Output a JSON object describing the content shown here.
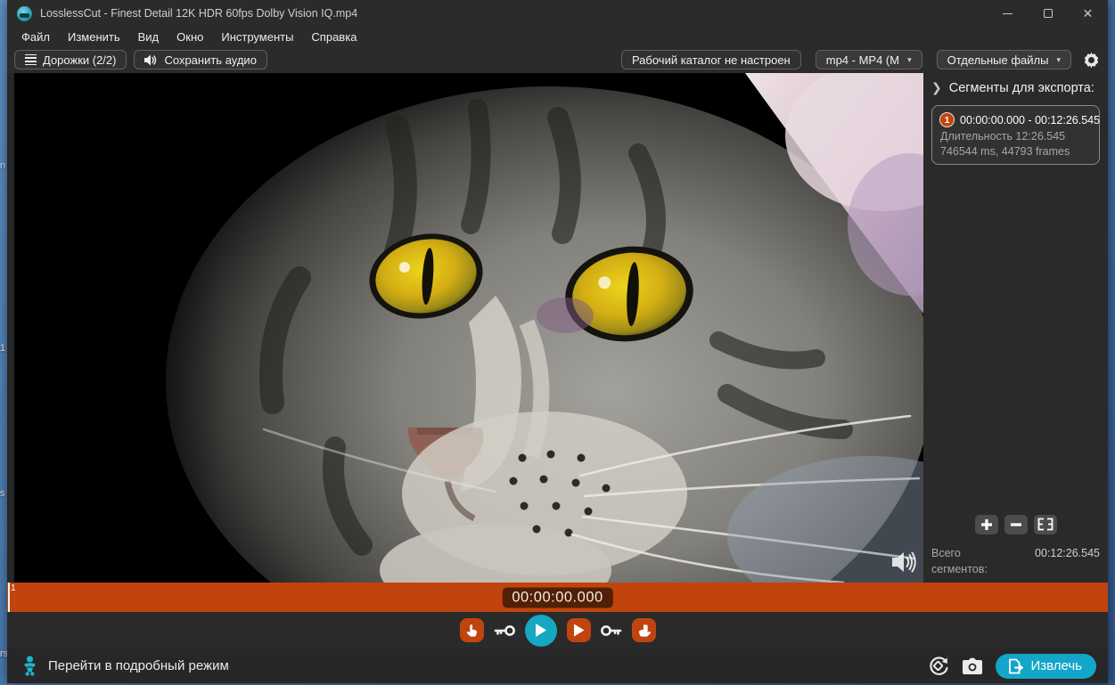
{
  "desktop": {
    "fragments": [
      "n",
      "1",
      "s",
      "rs"
    ]
  },
  "window": {
    "title": "LosslessCut - Finest Detail 12K HDR 60fps Dolby Vision IQ.mp4"
  },
  "menu": {
    "items": [
      "Файл",
      "Изменить",
      "Вид",
      "Окно",
      "Инструменты",
      "Справка"
    ]
  },
  "toolbar": {
    "tracks_label": "Дорожки (2/2)",
    "keep_audio_label": "Сохранить аудио",
    "working_dir_label": "Рабочий каталог не настроен",
    "format_value": "mp4 - MP4 (M",
    "export_mode_value": "Отдельные файлы",
    "caret_icon": "▾"
  },
  "sidebar": {
    "chevron_icon": "❯",
    "header": "Сегменты для экспорта:",
    "segment": {
      "index": "1",
      "range": "00:00:00.000 - 00:12:26.545",
      "duration": "Длительность 12:26.545",
      "details": "746544 ms, 44793 frames"
    },
    "total_label": "Всего сегментов:",
    "total_value": "00:12:26.545"
  },
  "timeline": {
    "segment_label": "1",
    "current_time": "00:00:00.000"
  },
  "footer": {
    "advanced_mode_label": "Перейти в подробный режим",
    "export_label": "Извлечь"
  },
  "colors": {
    "accent_orange": "#c1440e",
    "accent_teal": "#12a6c9",
    "window_bg": "#2b2b2b"
  }
}
